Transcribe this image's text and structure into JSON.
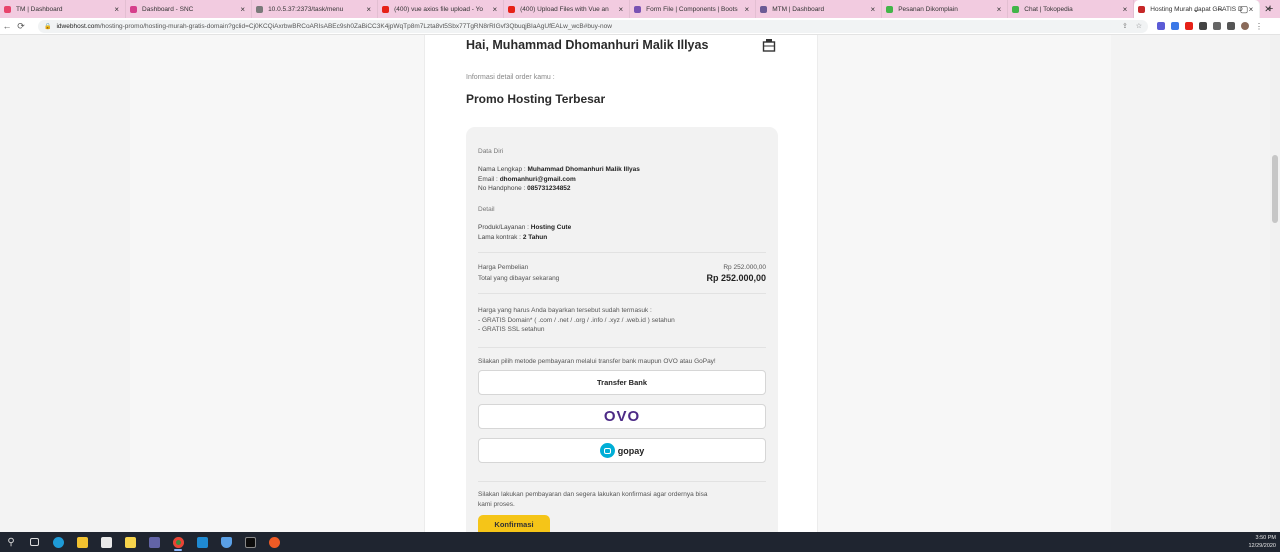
{
  "browser": {
    "tabs": [
      {
        "title": "TM | Dashboard",
        "color": "#e8436b"
      },
      {
        "title": "Dashboard - SNC",
        "color": "#d63f8c"
      },
      {
        "title": "10.0.5.37:2373/task/menu",
        "color": "#7a7a7a"
      },
      {
        "title": "(400) vue axios file upload - Yo",
        "color": "#e62117"
      },
      {
        "title": "(400) Upload Files with Vue an",
        "color": "#e62117"
      },
      {
        "title": "Form File | Components | Boots",
        "color": "#7952b3"
      },
      {
        "title": "MTM | Dashboard",
        "color": "#6b5b95"
      },
      {
        "title": "Pesanan Dikomplain",
        "color": "#42b549"
      },
      {
        "title": "Chat | Tokopedia",
        "color": "#42b549"
      },
      {
        "title": "Hosting Murah dapat GRATIS D",
        "color": "#c62828",
        "active": true
      }
    ],
    "new_tab": "+",
    "url_prefix": "idwebhost.com",
    "url_rest": "/hosting-promo/hosting-murah-gratis-domain?gclid=Cj0KCQiAxrbwBRCoARIsABEc9sh0ZaBiCC3K4jpWqTp8m7Lzta8vt5Sbx77TgRN8rRIGvf3QbuqjBIaAgUfEALw_wcB#buy-now"
  },
  "page": {
    "greeting": "Hai, Muhammad Dhomanhuri Malik Illyas",
    "info_label": "Informasi detail order kamu :",
    "promo_title": "Promo Hosting Terbesar",
    "data_diri": {
      "label": "Data Diri",
      "name_key": "Nama Lengkap :",
      "name_val": "Muhammad Dhomanhuri Malik Illyas",
      "email_key": "Email :",
      "email_val": "dhomanhuri@gmail.com",
      "phone_key": "No Handphone :",
      "phone_val": "085731234852"
    },
    "detail": {
      "label": "Detail",
      "product_key": "Produk/Layanan :",
      "product_val": "Hosting Cute",
      "contract_key": "Lama kontrak :",
      "contract_val": "2 Tahun"
    },
    "pricing": {
      "price_label": "Harga Pembelian",
      "price_val": "Rp 252.000,00",
      "total_label": "Total yang dibayar sekarang",
      "total_val": "Rp 252.000,00"
    },
    "includes": {
      "intro": "Harga yang harus Anda bayarkan tersebut sudah termasuk :",
      "item1": "- GRATIS Domain* ( .com / .net / .org / .info / .xyz / .web.id ) setahun",
      "item2": "- GRATIS SSL setahun"
    },
    "payment": {
      "prompt": "Silakan pilih metode pembayaran melalui transfer bank maupun OVO atau GoPay!",
      "transfer_label": "Transfer Bank",
      "ovo_label": "OVO",
      "gopay_label": "gopay"
    },
    "footer_note_1": "Silakan lakukan pembayaran dan segera lakukan konfirmasi agar ordernya bisa",
    "footer_note_2": "kami proses.",
    "confirm_label": "Konfirmasi"
  },
  "taskbar": {
    "time": "3:50 PM",
    "date": "12/29/2020"
  }
}
